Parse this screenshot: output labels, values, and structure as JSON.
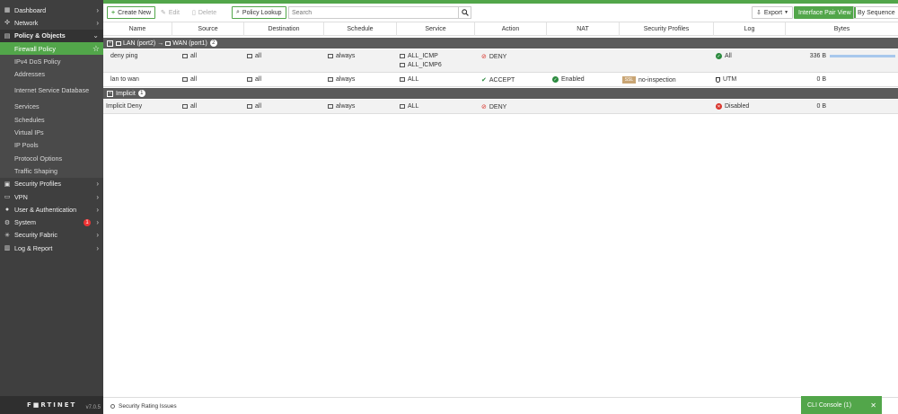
{
  "sidebar": {
    "items": [
      {
        "label": "Dashboard",
        "icon": "dashboard-icon"
      },
      {
        "label": "Network",
        "icon": "network-icon"
      },
      {
        "label": "Policy & Objects",
        "icon": "policy-icon"
      },
      {
        "label": "Security Profiles",
        "icon": "security-profiles-icon"
      },
      {
        "label": "VPN",
        "icon": "vpn-icon"
      },
      {
        "label": "User & Authentication",
        "icon": "user-icon"
      },
      {
        "label": "System",
        "icon": "system-icon",
        "badge": "1"
      },
      {
        "label": "Security Fabric",
        "icon": "fabric-icon"
      },
      {
        "label": "Log & Report",
        "icon": "log-icon"
      }
    ],
    "sub_items": [
      "Firewall Policy",
      "IPv4 DoS Policy",
      "Addresses",
      "Internet Service Database",
      "Services",
      "Schedules",
      "Virtual IPs",
      "IP Pools",
      "Protocol Options",
      "Traffic Shaping"
    ],
    "brand": "F■RTINET",
    "version": "v7.0.5"
  },
  "toolbar": {
    "create_new": "Create New",
    "edit": "Edit",
    "delete": "Delete",
    "policy_lookup": "Policy Lookup",
    "search_placeholder": "Search",
    "export": "Export",
    "interface_pair_view": "Interface Pair View",
    "by_sequence": "By Sequence"
  },
  "table": {
    "columns": [
      "Name",
      "Source",
      "Destination",
      "Schedule",
      "Service",
      "Action",
      "NAT",
      "Security Profiles",
      "Log",
      "Bytes"
    ],
    "group1": {
      "from": "LAN (port2)",
      "to": "WAN (port1)",
      "count": "2"
    },
    "rows": [
      {
        "name": "deny ping",
        "source": "all",
        "destination": "all",
        "schedule": "always",
        "service": "ALL_ICMP",
        "service2": "ALL_ICMP6",
        "action": "DENY",
        "nat": "",
        "profile_badge": "",
        "profile": "",
        "log": "All",
        "bytes": "336 B"
      },
      {
        "name": "lan to wan",
        "source": "all",
        "destination": "all",
        "schedule": "always",
        "service": "ALL",
        "action": "ACCEPT",
        "nat": "Enabled",
        "profile_badge": "SSL",
        "profile": "no-inspection",
        "log": "UTM",
        "bytes": "0 B"
      }
    ],
    "group2": {
      "label": "Implicit",
      "count": "1"
    },
    "implicit_row": {
      "name": "Implicit Deny",
      "source": "all",
      "destination": "all",
      "schedule": "always",
      "service": "ALL",
      "action": "DENY",
      "log": "Disabled",
      "bytes": "0 B"
    }
  },
  "footer": {
    "security_rating": "Security Rating Issues",
    "cli_console": "CLI Console (1)"
  },
  "colors": {
    "accent": "#52a64a",
    "sidebar_bg": "#3f3f3f",
    "deny": "#d9342b",
    "accept": "#2b8a3e",
    "bytes_bar": "#a8c8ec"
  }
}
